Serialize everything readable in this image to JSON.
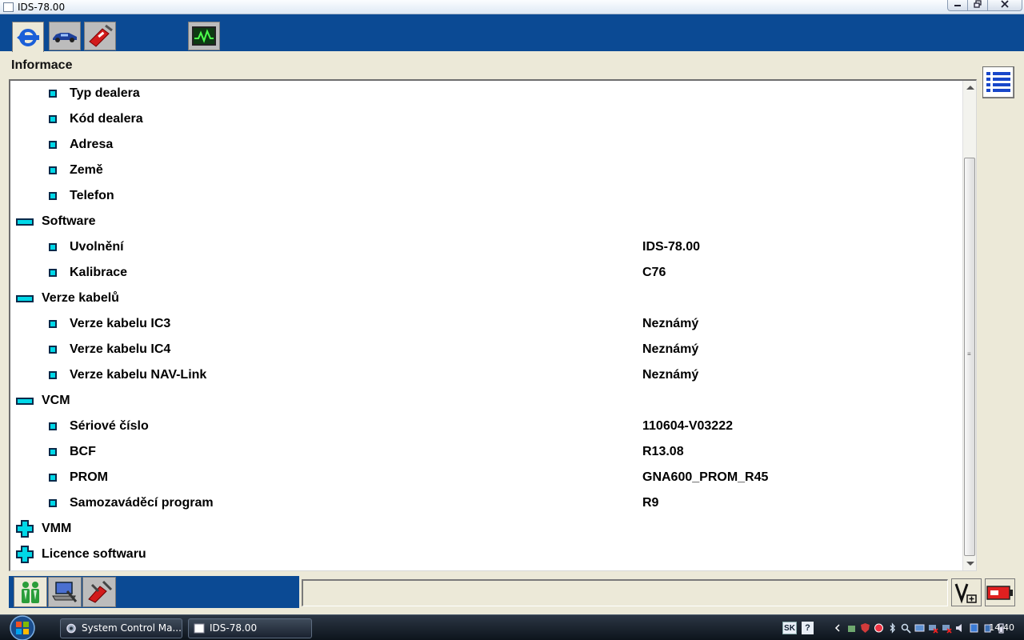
{
  "window": {
    "title": "IDS-78.00",
    "buttons": [
      "minimize",
      "maximize",
      "close"
    ]
  },
  "panel": {
    "title": "Informace"
  },
  "tree": [
    {
      "level": "item",
      "label": "Typ dealera",
      "value": ""
    },
    {
      "level": "item",
      "label": "Kód dealera",
      "value": ""
    },
    {
      "level": "item",
      "label": "Adresa",
      "value": ""
    },
    {
      "level": "item",
      "label": "Země",
      "value": ""
    },
    {
      "level": "item",
      "label": "Telefon",
      "value": ""
    },
    {
      "level": "group-expanded",
      "label": "Software",
      "value": ""
    },
    {
      "level": "item",
      "label": "Uvolnění",
      "value": "IDS-78.00"
    },
    {
      "level": "item",
      "label": "Kalibrace",
      "value": "C76"
    },
    {
      "level": "group-expanded",
      "label": "Verze kabelů",
      "value": ""
    },
    {
      "level": "item",
      "label": "Verze kabelu IC3",
      "value": "Neznámý"
    },
    {
      "level": "item",
      "label": "Verze kabelu IC4",
      "value": "Neznámý"
    },
    {
      "level": "item",
      "label": "Verze kabelu NAV-Link",
      "value": "Neznámý"
    },
    {
      "level": "group-expanded",
      "label": "VCM",
      "value": ""
    },
    {
      "level": "item",
      "label": "Sériové číslo",
      "value": "110604-V03222"
    },
    {
      "level": "item",
      "label": "BCF",
      "value": "R13.08"
    },
    {
      "level": "item",
      "label": "PROM",
      "value": "GNA600_PROM_R45"
    },
    {
      "level": "item",
      "label": "Samozaváděcí program",
      "value": "R9"
    },
    {
      "level": "group-collapsed",
      "label": "VMM",
      "value": ""
    },
    {
      "level": "group-collapsed",
      "label": "Licence softwaru",
      "value": ""
    }
  ],
  "taskbar": {
    "items": [
      "System Control Ma...",
      "IDS-78.00"
    ],
    "lang": "SK",
    "help": "?",
    "clock": "14:40"
  },
  "colors": {
    "toolbar_blue": "#0b4a94",
    "icon_cyan": "#00d8e8",
    "window_bg": "#ece9d8"
  }
}
